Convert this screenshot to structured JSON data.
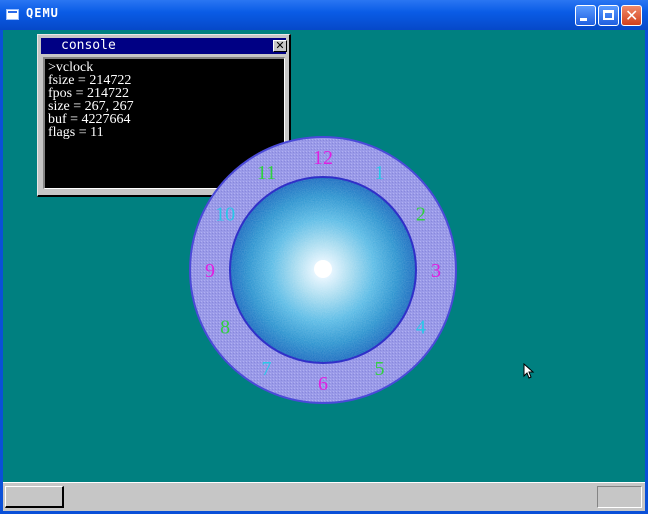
{
  "window": {
    "title": "QEMU",
    "buttons": [
      "minimize",
      "maximize",
      "close"
    ]
  },
  "desktop": {
    "background": "#008080"
  },
  "console": {
    "title": "console",
    "lines": [
      ">vclock",
      "fsize = 214722",
      "fpos = 214722",
      "size = 267, 267",
      "buf = 4227664",
      "flags = 11"
    ]
  },
  "clock": {
    "numerals": [
      {
        "n": "12",
        "color": "#e020e0"
      },
      {
        "n": "1",
        "color": "#28c8e8"
      },
      {
        "n": "2",
        "color": "#30d040"
      },
      {
        "n": "3",
        "color": "#e020e0"
      },
      {
        "n": "4",
        "color": "#28c8e8"
      },
      {
        "n": "5",
        "color": "#30d040"
      },
      {
        "n": "6",
        "color": "#e020e0"
      },
      {
        "n": "7",
        "color": "#28c8e8"
      },
      {
        "n": "8",
        "color": "#30d040"
      },
      {
        "n": "9",
        "color": "#e020e0"
      },
      {
        "n": "10",
        "color": "#28c8e8"
      },
      {
        "n": "11",
        "color": "#30d040"
      }
    ],
    "ring_color": "#9a9ae8",
    "face_color": "#3aa8d8"
  },
  "taskbar": {
    "background": "#c6c6c6"
  }
}
